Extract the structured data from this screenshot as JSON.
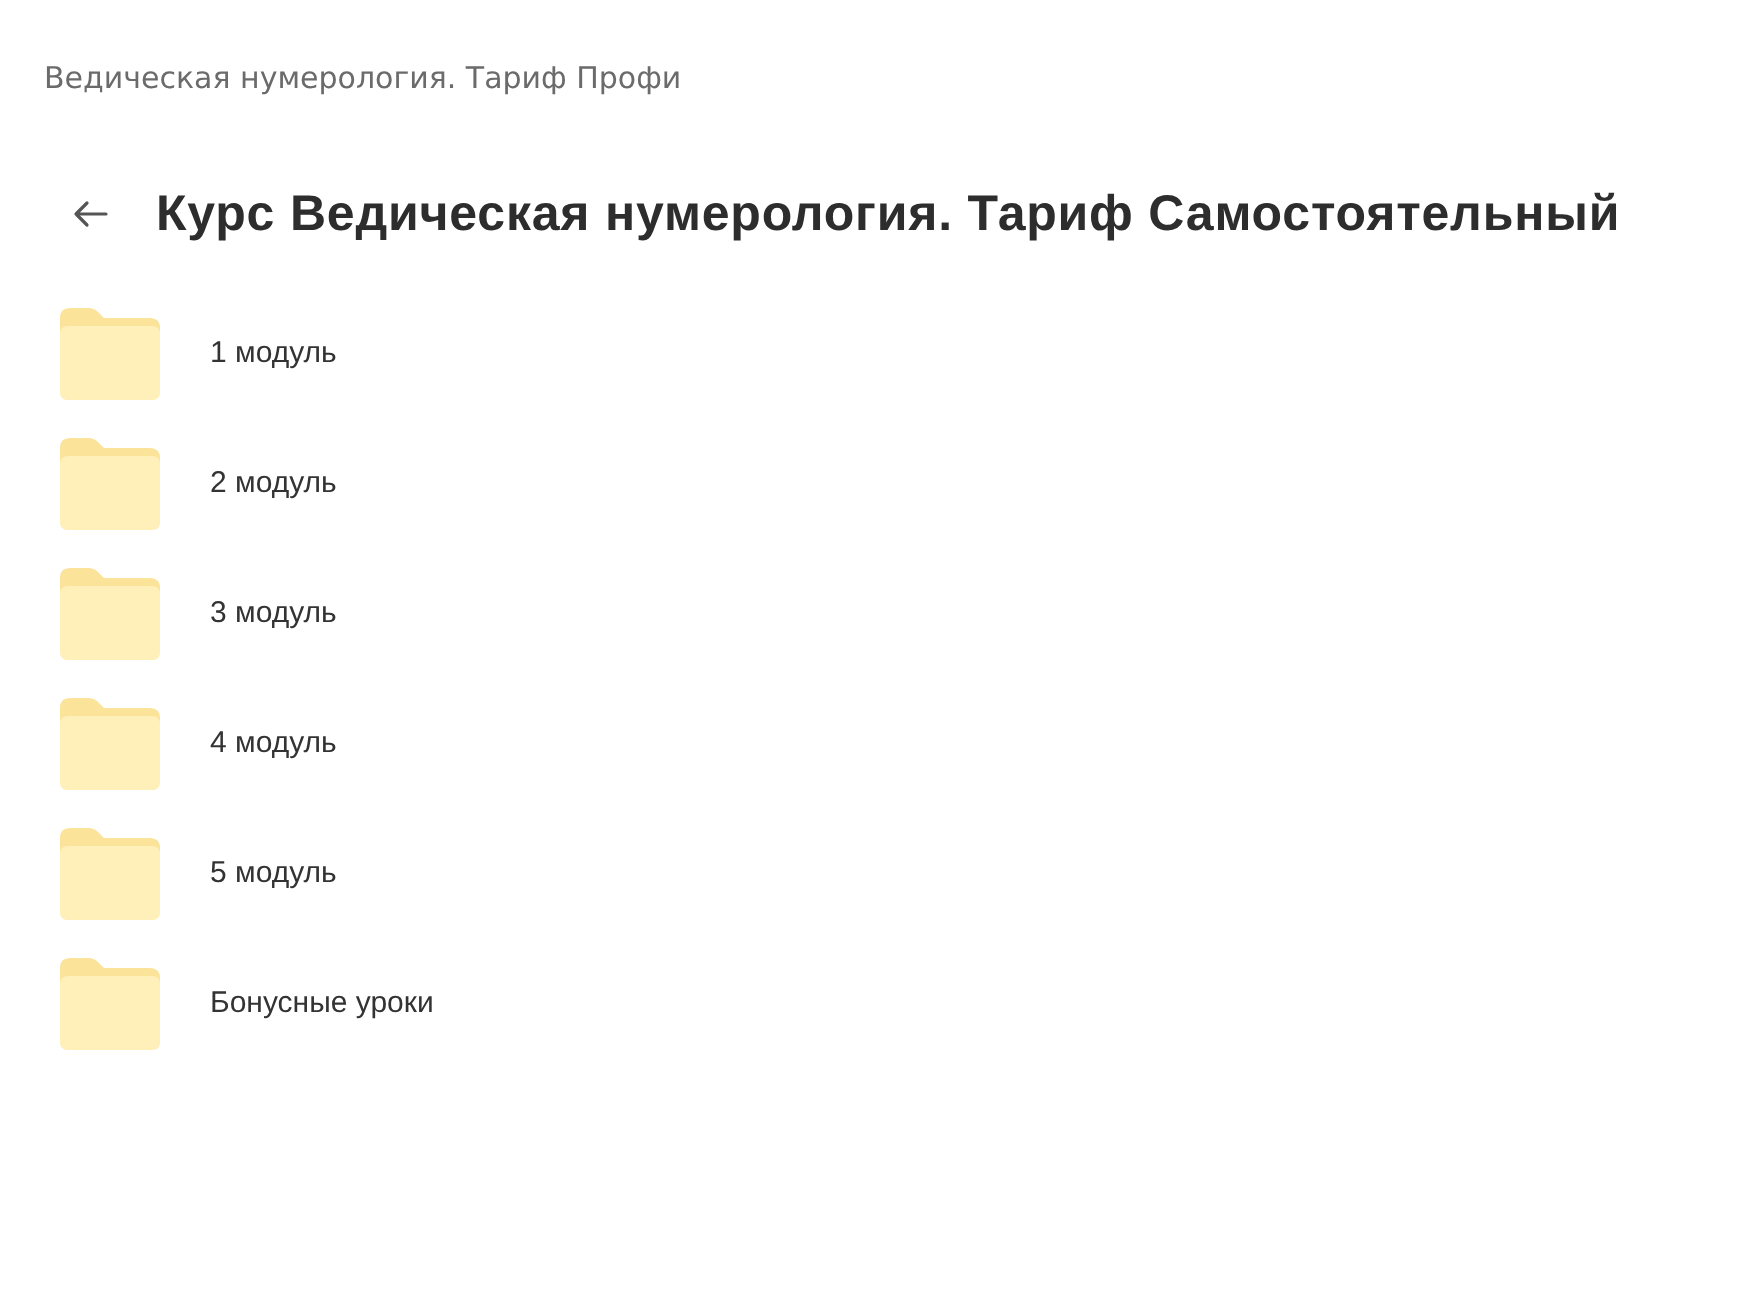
{
  "breadcrumb": "Ведическая нумерология. Тариф Профи",
  "title": "Курс Ведическая нумерология. Тариф Самостоятельный",
  "folders": [
    {
      "name": "1 модуль"
    },
    {
      "name": "2 модуль"
    },
    {
      "name": "3 модуль"
    },
    {
      "name": "4 модуль"
    },
    {
      "name": "5 модуль"
    },
    {
      "name": "Бонусные уроки"
    }
  ]
}
